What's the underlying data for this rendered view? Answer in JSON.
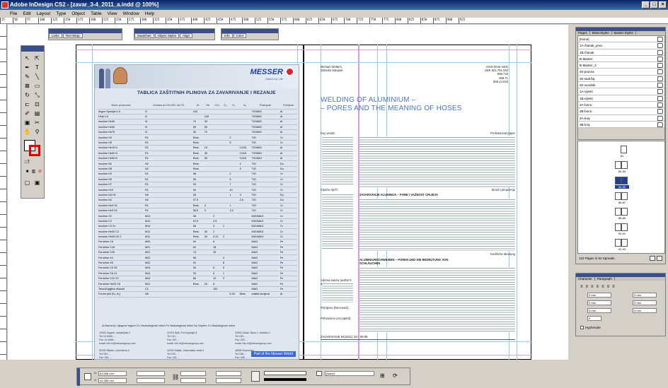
{
  "window": {
    "title": "Adobe InDesign CS2 - [zavar_3-4_2011_a.indd @ 100%]"
  },
  "menu": [
    "File",
    "Edit",
    "Layout",
    "Type",
    "Object",
    "Table",
    "View",
    "Window",
    "Help"
  ],
  "ruler": [
    "25",
    "50",
    "75",
    "100",
    "125",
    "150",
    "175",
    "200",
    "225",
    "250",
    "275",
    "300",
    "325",
    "350",
    "375",
    "400",
    "425",
    "450",
    "475",
    "500",
    "525",
    "550",
    "575",
    "600",
    "625",
    "650",
    "675",
    "700",
    "725",
    "750",
    "775",
    "800",
    "825",
    "850",
    "875",
    "900",
    "925"
  ],
  "floating_panels": [
    {
      "tabs": [
        "Links",
        "Text Wrap"
      ]
    },
    {
      "tabs": [
        "Swatches",
        "Object Styles",
        "Align"
      ]
    },
    {
      "tabs": [
        "Info",
        "Color"
      ]
    }
  ],
  "ad": {
    "brand": "MESSER",
    "brand_sub": "Gases for Life",
    "title": "TABLICA ZAŠTITNIH PLINOVA ZA ZAVARIVANJE I REZANJE",
    "headers": [
      "Naziv proizvoda",
      "Oznaka po EN ISO 14175",
      "Ar",
      "He",
      "CO₂",
      "O₂",
      "H₂",
      "N₂",
      "Postupak",
      "Primjena"
    ],
    "rows": [
      [
        "Argon Specijal 4.6",
        "I1",
        "100",
        "",
        "",
        "",
        "",
        "",
        "TIG/MIG",
        "Al"
      ],
      [
        "Helij 4.6",
        "I2",
        "",
        "100",
        "",
        "",
        "",
        "",
        "TIG/MIG",
        "Al"
      ],
      [
        "Inoxline He30",
        "I3",
        "70",
        "30",
        "",
        "",
        "",
        "",
        "TIG/MIG",
        "Al"
      ],
      [
        "Inoxline He50",
        "I3",
        "50",
        "50",
        "",
        "",
        "",
        "",
        "TIG/MIG",
        "Al"
      ],
      [
        "Inoxline He70",
        "I3",
        "30",
        "70",
        "",
        "",
        "",
        "",
        "TIG/MIG",
        "Al"
      ],
      [
        "Inoxline H2",
        "R1",
        "Rest.",
        "",
        "",
        "",
        "2",
        "",
        "TIG",
        "Cr"
      ],
      [
        "Inoxline H5",
        "R1",
        "Rest.",
        "",
        "",
        "",
        "5",
        "",
        "TIG",
        "Cr"
      ],
      [
        "Inoxline He15 N",
        "R1",
        "Rest.",
        "15",
        "",
        "",
        "",
        "0,015",
        "TIG/MIG",
        "Al"
      ],
      [
        "Inoxline He30 N",
        "R1",
        "Rest.",
        "30",
        "",
        "",
        "",
        "0,015",
        "TIG/MIG",
        "Al"
      ],
      [
        "Inoxline He50 N",
        "R1",
        "Rest.",
        "50",
        "",
        "",
        "",
        "0,015",
        "TIG/MIG",
        "Al"
      ],
      [
        "Inoxline N2",
        "N2",
        "Rest.",
        "",
        "",
        "",
        "",
        "2",
        "TIG",
        "Du"
      ],
      [
        "Inoxline N5",
        "N2",
        "Rest.",
        "",
        "",
        "",
        "",
        "5",
        "TIG",
        "Du"
      ],
      [
        "Inoxline H2",
        "R1",
        "98",
        "",
        "",
        "",
        "2",
        "",
        "TIG",
        "Cr"
      ],
      [
        "Inoxline H5",
        "R1",
        "95",
        "",
        "",
        "",
        "5",
        "",
        "TIG",
        "Cr"
      ],
      [
        "Inoxline H7",
        "R1",
        "93",
        "",
        "",
        "",
        "7",
        "",
        "TIG",
        "Cr"
      ],
      [
        "Inoxline H10",
        "R1",
        "90",
        "",
        "",
        "",
        "10",
        "",
        "TIG",
        "Cr"
      ],
      [
        "Inoxline N3 H1",
        "N5",
        "96",
        "",
        "",
        "",
        "1",
        "3",
        "TIG",
        "Du"
      ],
      [
        "Inoxline N2",
        "N2",
        "97,5",
        "",
        "",
        "",
        "",
        "2,5",
        "TIG",
        "Du"
      ],
      [
        "Inoxline He3 H1",
        "R1",
        "Rest.",
        "3",
        "",
        "",
        "1",
        "",
        "TIG",
        "Cr"
      ],
      [
        "Inoxline He3 H1",
        "R1",
        "95,5",
        "3",
        "",
        "",
        "1,5",
        "",
        "TIG",
        "Cr"
      ],
      [
        "Inoxline X2",
        "M12",
        "98",
        "",
        "2",
        "",
        "",
        "",
        "MIG/MAG",
        "Cr"
      ],
      [
        "Inoxline C2",
        "M12",
        "97,5",
        "",
        "2,5",
        "",
        "",
        "",
        "MIG/MAG",
        "Cr"
      ],
      [
        "Inoxline C3 X1",
        "M14",
        "96",
        "",
        "3",
        "1",
        "",
        "",
        "MIG/MAG",
        "Cr"
      ],
      [
        "Inoxline He30 C2",
        "M12",
        "Rest.",
        "30",
        "2",
        "",
        "",
        "",
        "MIG/MAG",
        "Cr"
      ],
      [
        "Inoxline He30 H2 C",
        "M11",
        "Rest.",
        "30",
        "0,12",
        "2",
        "",
        "",
        "MIG/MAG",
        "Cr"
      ],
      [
        "Ferroline C6",
        "M20",
        "94",
        "",
        "6",
        "",
        "",
        "",
        "MAG",
        "Fe"
      ],
      [
        "Ferroline C18",
        "M21",
        "82",
        "",
        "18",
        "",
        "",
        "",
        "MAG",
        "Fe"
      ],
      [
        "Ferroline C25",
        "M21",
        "75",
        "",
        "25",
        "",
        "",
        "",
        "MAG",
        "Fe"
      ],
      [
        "Ferroline X4",
        "M22",
        "96",
        "",
        "",
        "4",
        "",
        "",
        "MAG",
        "Fe"
      ],
      [
        "Ferroline X8",
        "M22",
        "92",
        "",
        "",
        "8",
        "",
        "",
        "MAG",
        "Fe"
      ],
      [
        "Ferroline C5 X5",
        "M23",
        "90",
        "",
        "5",
        "5",
        "",
        "",
        "MAG",
        "Fe"
      ],
      [
        "Ferroline C6 X1",
        "M24",
        "93",
        "",
        "6",
        "1",
        "",
        "",
        "MAG",
        "Fe"
      ],
      [
        "Ferroline C12 X2",
        "M24",
        "86",
        "",
        "12",
        "2",
        "",
        "",
        "MAG",
        "Fe"
      ],
      [
        "Ferroline He20 C8",
        "M21",
        "Rest.",
        "20",
        "8",
        "",
        "",
        "",
        "MAG",
        "Fe"
      ],
      [
        "Tekući/Ugljični dioksid",
        "C1",
        "",
        "",
        "100",
        "",
        "",
        "",
        "MAG",
        "Fe"
      ],
      [
        "Formir plin (N₂-H₂)",
        "N5",
        "",
        "",
        "",
        "",
        "5-20",
        "Rest.",
        "zaštita korijena",
        "Al"
      ]
    ],
    "legend": "Al  Aluminij i njegove legure   Cr  Visokolegirani čelici   Fe  Niskolegirani čelici   Du  Duplex   Cr  Niskolegirani čelici",
    "contacts": [
      "10000 Zagreb, Industrijska 1\nTel: 01 6066 ...\nFax: 01 6066 ...\nemail: info.hr@messergroup.com\n\n51000 Rijeka, Lukovićeva 4\nTel: 051 ...\nFax: 051 ...\nemail: info.hr@messergroup.com",
      "21210 Split, Put Supavlja 8\nTel: 021 ...\nFax: 021 ...\nemail: info.hr@messergroup.com\n\n31000 Osijek, Vinkovačka cesta 1\nTel: 031 ...\nFax: 031 ...\nemail: info.hr@messergroup.com",
      "23000 Zadar, Bana J. Jelačića 1\nTel: 023 ...\nFax: 023 ...\nemail: info.hr@messergroup.com\n\n48000 Koprivnica, ...\nTel: 048 ...\nFax: 048 ...\nemail: info.hr@messergroup.com"
    ],
    "part_of": "Part of the Messer World"
  },
  "right_page": {
    "authors": [
      "Michael Wolters,",
      "Zdravko Salopek"
    ],
    "issn": [
      "ISSN 0044-1902",
      "UDK 621.791.053",
      "669.715",
      "669.71",
      "669.14.018"
    ],
    "headline_1": "WELDING OF ALUMINIUM –",
    "headline_2": "– PORES AND THE MEANING OF HOSES",
    "key_words_label": "Key words:",
    "kljucne_label": "Ključne riječi:",
    "professional_label": "Professional paper",
    "summary_hr_head": "ZAVARIVANJE ALUMINIJA – PORE I VAŽNOST CRIJEVA",
    "summary_de_head": "ALUMINIUMSCHWEIBEN – POREN UND DIE BEDEUTUNG VON SCHLÄUCHEN",
    "strucni_label": "Stručni priopćenje",
    "fachliche_label": "Fachliche Meinung",
    "address_label": "Adresa autora (author's address):",
    "primljeno": "Primljeno (Received):",
    "prihvaceno": "Prihvaćeno (Accepted):",
    "footer": "ZAVARIVANJE 54(2011) 3/4 : 85-89"
  },
  "pages_panel": {
    "tabs": [
      "Pages",
      "Meta-Styles",
      "Master Styles"
    ],
    "items": [
      "[None]",
      "1A-članak_prva",
      "1B-članak",
      "B-Master",
      "B-Master_2",
      "20-prazna",
      "30-sadržaj",
      "32-uvodnik",
      "1A-vijesti",
      "1B-vijesti",
      "2A-bono",
      "2B-bono",
      "3A-kraj",
      "3B-kraj"
    ],
    "spreads": [
      "81",
      "82-83",
      "84-85",
      "86-87",
      "88-89",
      "90-91",
      "92-93"
    ],
    "footer_text": "122 Pages in 62 Spreads"
  },
  "char_panel": {
    "tabs": [
      "Character",
      "Paragraph"
    ],
    "values": [
      "0 mm",
      "0 mm",
      "0 mm",
      "0 mm",
      "0 mm",
      "0 mm",
      "0"
    ],
    "hyphenate": "Hyphenate"
  },
  "statusbar": {
    "x": "63,558 mm",
    "y": "44,385 mm",
    "style": "[None]",
    "zoom": "100%"
  }
}
